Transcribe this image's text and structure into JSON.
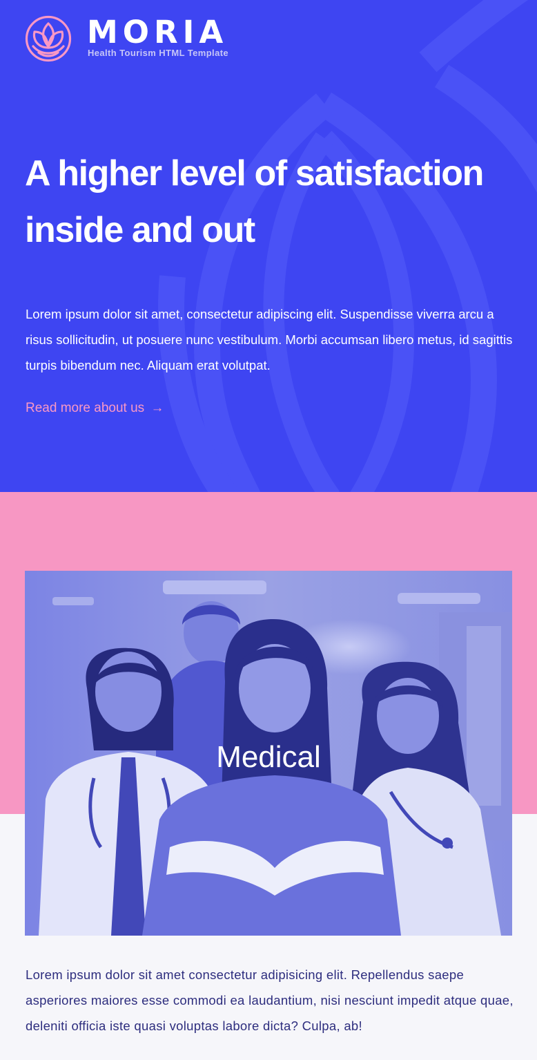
{
  "brand": {
    "name": "MORIA",
    "tagline": "Health Tourism HTML Template",
    "logo_icon": "lotus-icon",
    "logo_color": "#F998C5"
  },
  "hero": {
    "title": "A higher level of satisfaction inside and out",
    "body": "Lorem ipsum dolor sit amet, consectetur adipiscing elit. Suspendisse viverra arcu a risus sollicitudin, ut posuere nunc vestibulum. Morbi accumsan libero metus, id sagittis turpis bibendum nec. Aliquam erat volutpat.",
    "link_label": "Read more about us",
    "link_arrow": "→",
    "background_color": "#3E45F2",
    "link_color": "#F998C5"
  },
  "feature_card": {
    "label": "Medical",
    "body": "Lorem ipsum dolor sit amet consectetur adipisicing elit. Repellendus saepe asperiores maiores esse commodi ea laudantium, nisi nesciunt impedit atque quae, deleniti officia iste quasi voluptas labore dicta? Culpa, ab!",
    "band_color": "#F797C3",
    "image_tint": "#5B62E8"
  }
}
